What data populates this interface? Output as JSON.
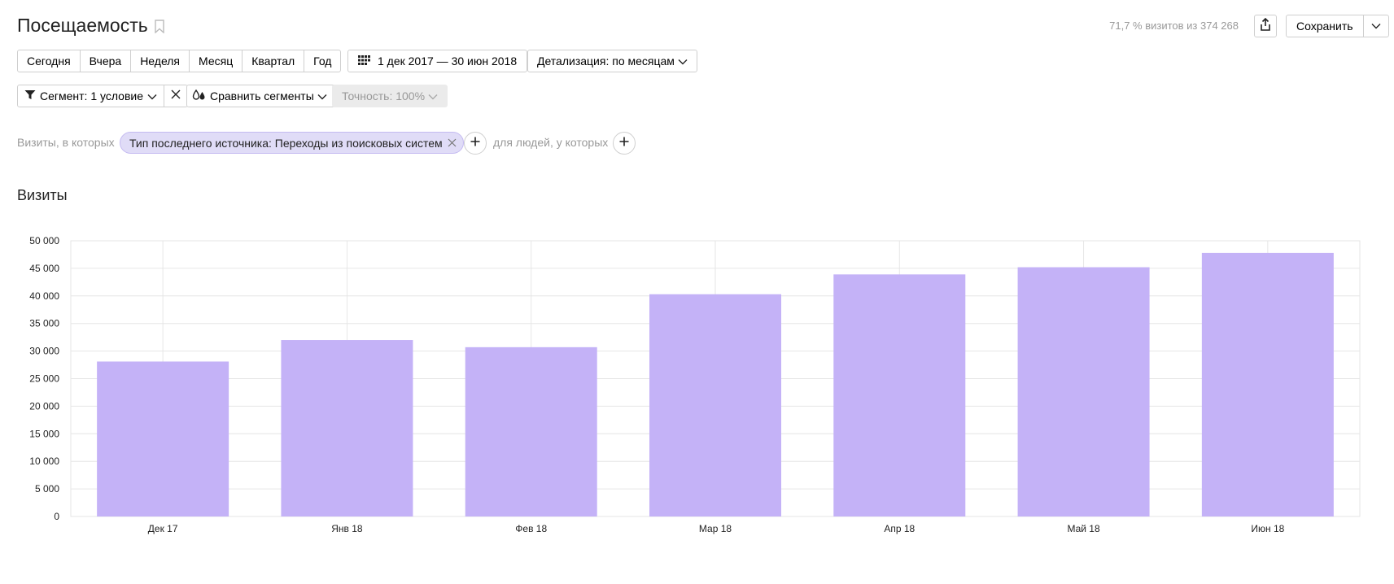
{
  "header": {
    "title": "Посещаемость",
    "visits_share": "71,7 % визитов из 374 268",
    "save_label": "Сохранить"
  },
  "period_buttons": [
    "Сегодня",
    "Вчера",
    "Неделя",
    "Месяц",
    "Квартал",
    "Год"
  ],
  "date_range": "1 дек 2017 — 30 июн 2018",
  "detail": "Детализация: по месяцам",
  "segment": {
    "label": "Сегмент: 1 условие",
    "compare_label": "Сравнить сегменты",
    "accuracy_label": "Точность: 100%"
  },
  "filter": {
    "prefix": "Визиты, в которых",
    "chip": "Тип последнего источника: Переходы из поисковых систем",
    "people": "для людей, у которых"
  },
  "chart_heading": "Визиты",
  "chart_data": {
    "type": "bar",
    "title": "Визиты",
    "categories": [
      "Дек 17",
      "Янв 18",
      "Фев 18",
      "Мар 18",
      "Апр 18",
      "Май 18",
      "Июн 18"
    ],
    "values": [
      28100,
      32000,
      30700,
      40300,
      43900,
      45200,
      47800
    ],
    "ylim": [
      0,
      50000
    ],
    "yticks": [
      "0",
      "5 000",
      "10 000",
      "15 000",
      "20 000",
      "25 000",
      "30 000",
      "35 000",
      "40 000",
      "45 000",
      "50 000"
    ],
    "grid": true,
    "bar_color": "#c4b2f7"
  }
}
